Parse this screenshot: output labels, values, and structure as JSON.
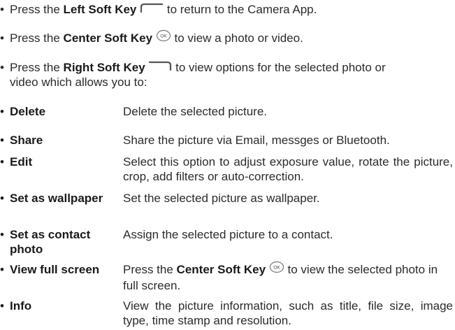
{
  "intro": {
    "left": {
      "before": "Press the ",
      "key": "Left Soft Key",
      "after": " to return to the Camera App.",
      "icon": "left-soft-key-icon"
    },
    "center": {
      "before": "Press the ",
      "key": "Center Soft Key",
      "after": " to view a photo or video.",
      "icon": "ok-key-icon"
    },
    "right": {
      "before": "Press the ",
      "key": "Right Soft Key",
      "after": " to view options for the selected photo or",
      "continuation": "video which allows you to:",
      "icon": "right-soft-key-icon"
    }
  },
  "options": [
    {
      "term": "Delete",
      "desc": "Delete the selected picture."
    },
    {
      "term": "Share",
      "desc": "Share the picture via Email, messges or Bluetooth."
    },
    {
      "term": "Edit",
      "desc": "Select this option to adjust exposure value, rotate the picture, crop, add filters or auto-correction."
    },
    {
      "term": "Set as wallpaper",
      "desc": "Set the selected picture as wallpaper."
    },
    {
      "term": "Set as contact photo",
      "desc": "Assign the selected picture to a contact."
    },
    {
      "term": "View full screen",
      "desc_before": "Press the ",
      "desc_key": "Center Soft Key",
      "desc_after": " to view the selected photo in full screen.",
      "icon": "ok-key-icon"
    },
    {
      "term": "Info",
      "desc": "View the picture information, such as title, file size, image type, time stamp and resolution."
    }
  ],
  "icon_label": "OK",
  "colors": {
    "text": "#2b2b2b",
    "icon_stroke": "#555555"
  }
}
